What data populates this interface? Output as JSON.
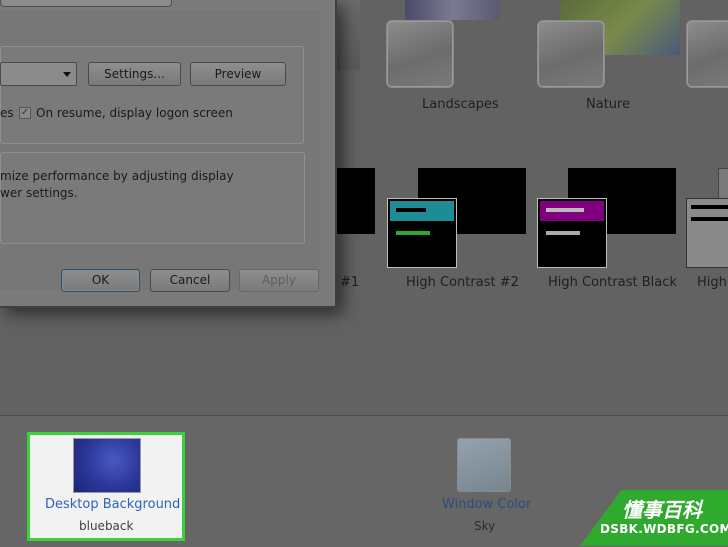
{
  "dialog": {
    "settings_label": "Settings...",
    "preview_label": "Preview",
    "checkbox_prefix": "es",
    "checkbox_label": "On resume, display logon screen",
    "power_text_line1": "mize performance by adjusting display",
    "power_text_line2": "wer settings.",
    "ok_label": "OK",
    "cancel_label": "Cancel",
    "apply_label": "Apply"
  },
  "themes": {
    "row1": [
      "Landscapes",
      "Nature"
    ],
    "row2": [
      "#1",
      "High Contrast #2",
      "High Contrast Black",
      "High"
    ]
  },
  "colors": {
    "hc2_accent": "#1e8c95",
    "hc2_green": "#2fa82f",
    "hcblack_accent": "#800080",
    "highlight_border": "#3ad13a",
    "link_blue": "#2f62b8",
    "watermark_green": "#2faa2f"
  },
  "bottom": {
    "desktop_background_label": "Desktop Background",
    "desktop_background_value": "blueback",
    "window_color_label": "Window Color",
    "window_color_value": "Sky"
  },
  "watermark": {
    "cn": "懂事百科",
    "en": "DSBK.WDBFG.COM"
  }
}
